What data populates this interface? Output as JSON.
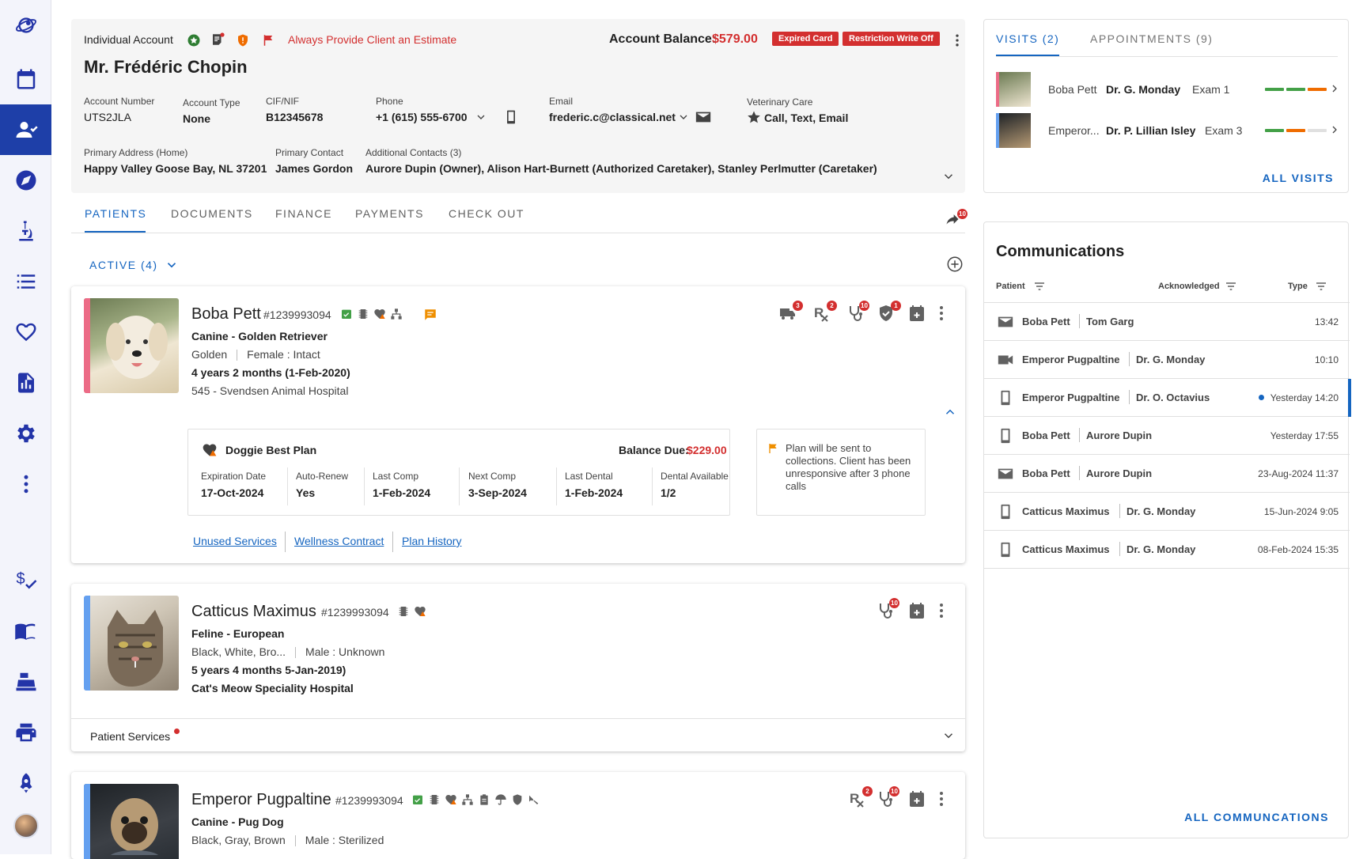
{
  "sidebar": {
    "items": [
      "logo-icon",
      "calendar-icon",
      "client-icon",
      "compass-icon",
      "microscope-icon",
      "list-icon",
      "heart-icon",
      "report-icon",
      "gear-icon",
      "more-vertical-icon",
      "billing-icon",
      "book-icon",
      "cash-register-icon",
      "printer-icon",
      "rocket-icon",
      "user-avatar"
    ],
    "active": "client-icon"
  },
  "client": {
    "account_kind": "Individual Account",
    "alert": "Always Provide Client an Estimate",
    "name": "Mr. Frédéric Chopin",
    "balance_label": "Account Balance:",
    "balance_value": "$579.00",
    "badges": [
      "Expired Card",
      "Restriction Write Off"
    ],
    "fields": {
      "account_number_label": "Account Number",
      "account_number": "UTS2JLA",
      "account_type_label": "Account Type",
      "account_type": "None",
      "cif_label": "CIF/NIF",
      "cif": "B12345678",
      "phone_label": "Phone",
      "phone": "+1 (615) 555-6700",
      "email_label": "Email",
      "email": "frederic.c@classical.net",
      "vet_care_label": "Veterinary Care",
      "vet_care": "Call, Text, Email",
      "address_label": "Primary Address (Home)",
      "address": "Happy Valley Goose Bay, NL 37201",
      "primary_contact_label": "Primary Contact",
      "primary_contact": "James Gordon",
      "additional_label": "Additional Contacts (3)",
      "additional": "Aurore Dupin (Owner), Alison Hart-Burnett (Authorized Caretaker), Stanley Perlmutter (Caretaker)"
    }
  },
  "tabs": [
    "PATIENTS",
    "DOCUMENTS",
    "FINANCE",
    "PAYMENTS",
    "CHECK OUT"
  ],
  "share_count": "10",
  "filter_label": "ACTIVE (4)",
  "patients": [
    {
      "name": "Boba Pett",
      "id": "#1239993094",
      "species": "Canine - Golden Retriever",
      "color": "Golden",
      "sex": "Female : Intact",
      "age": "4 years 2 months  (1-Feb-2020)",
      "hospital": "545 - Svendsen Animal Hospital",
      "counts": {
        "delivery": "3",
        "rx": "2",
        "stetho": "10",
        "shield": "1"
      },
      "plan": {
        "name": "Doggie Best Plan",
        "balance_label": "Balance Due:",
        "balance": "$229.00",
        "cols": [
          {
            "label": "Expiration Date",
            "value": "17-Oct-2024"
          },
          {
            "label": "Auto-Renew",
            "value": "Yes"
          },
          {
            "label": "Last Comp",
            "value": "1-Feb-2024"
          },
          {
            "label": "Next Comp",
            "value": "3-Sep-2024"
          },
          {
            "label": "Last Dental",
            "value": "1-Feb-2024"
          },
          {
            "label": "Dental Available",
            "value": "1/2"
          }
        ],
        "note": "Plan will be sent to collections. Client has been unresponsive after 3 phone calls",
        "links": [
          "Unused Services",
          "Wellness Contract",
          "Plan History"
        ]
      }
    },
    {
      "name": "Catticus Maximus",
      "id": "#1239993094",
      "species": "Feline - European",
      "color": "Black, White, Bro...",
      "sex": "Male : Unknown",
      "age": "5 years 4 months  5-Jan-2019)",
      "hospital": "Cat's Meow Speciality Hospital",
      "counts": {
        "stetho": "10"
      },
      "services_label": "Patient Services"
    },
    {
      "name": "Emperor Pugpaltine",
      "id": "#1239993094",
      "species": "Canine - Pug Dog",
      "color": "Black, Gray, Brown",
      "sex": "Male : Sterilized",
      "counts": {
        "rx": "2",
        "stetho": "10"
      }
    }
  ],
  "visits": {
    "tab_visits": "VISITS (2)",
    "tab_appointments": "APPOINTMENTS (9)",
    "rows": [
      {
        "patient": "Boba Pett",
        "doctor": "Dr. G. Monday",
        "exam": "Exam 1",
        "progress": [
          "#43a047",
          "#43a047",
          "#ef6c00"
        ]
      },
      {
        "patient": "Emperor...",
        "doctor": "Dr. P. Lillian Isley",
        "exam": "Exam 3",
        "progress": [
          "#43a047",
          "#ef6c00",
          "#e0e0e0"
        ]
      }
    ],
    "all_label": "ALL VISITS"
  },
  "communications": {
    "title": "Communications",
    "col_patient": "Patient",
    "col_ack": "Acknowledged",
    "col_type": "Type",
    "rows": [
      {
        "icon": "mail-icon",
        "patient": "Boba Pett",
        "person": "Tom Garg",
        "time": "13:42"
      },
      {
        "icon": "video-icon",
        "patient": "Emperor Pugpaltine",
        "person": "Dr. G. Monday",
        "time": "10:10"
      },
      {
        "icon": "phone-icon",
        "patient": "Emperor Pugpaltine",
        "person": "Dr. O. Octavius",
        "time": "Yesterday 14:20",
        "unread": true
      },
      {
        "icon": "phone-icon",
        "patient": "Boba Pett",
        "person": "Aurore Dupin",
        "time": "Yesterday 17:55"
      },
      {
        "icon": "mail-icon",
        "patient": "Boba Pett",
        "person": "Aurore Dupin",
        "time": "23-Aug-2024 11:37"
      },
      {
        "icon": "phone-icon",
        "patient": "Catticus Maximus",
        "person": "Dr. G. Monday",
        "time": "15-Jun-2024 9:05"
      },
      {
        "icon": "phone-icon",
        "patient": "Catticus Maximus",
        "person": "Dr. G. Monday",
        "time": "08-Feb-2024 15:35"
      }
    ],
    "all_label": "ALL COMMUNCATIONS"
  }
}
